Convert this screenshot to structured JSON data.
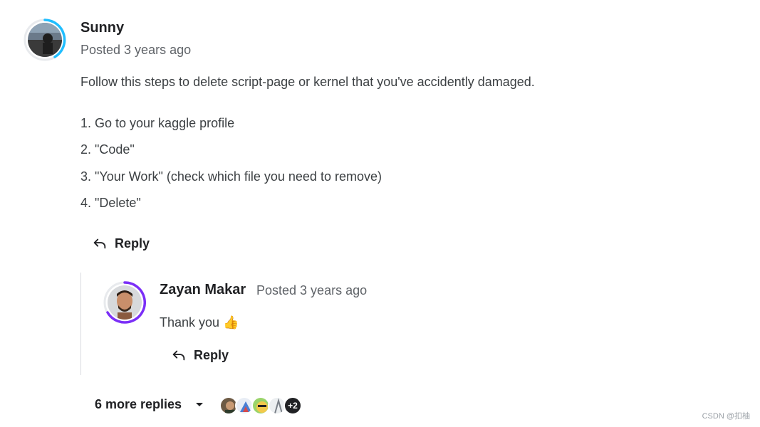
{
  "comment": {
    "author": "Sunny",
    "posted": "Posted 3 years ago",
    "intro": "Follow this steps to delete script-page or kernel that you've accidently damaged.",
    "steps": [
      "1. Go to your kaggle profile",
      "2. \"Code\"",
      "3. \"Your Work\" (check which file you need to remove)",
      "4. \"Delete\""
    ],
    "reply_label": "Reply",
    "avatar_ring_color": "#20beff"
  },
  "reply": {
    "author": "Zayan Makar",
    "posted": "Posted 3 years ago",
    "text": "Thank you 👍",
    "reply_label": "Reply",
    "avatar_ring_color": "#7b2ff7"
  },
  "more": {
    "label": "6 more replies",
    "extra_count": "+2",
    "avatars": [
      "user-avatar-1",
      "user-avatar-2",
      "user-avatar-3",
      "user-avatar-4"
    ]
  },
  "watermark": "CSDN @扣柚"
}
